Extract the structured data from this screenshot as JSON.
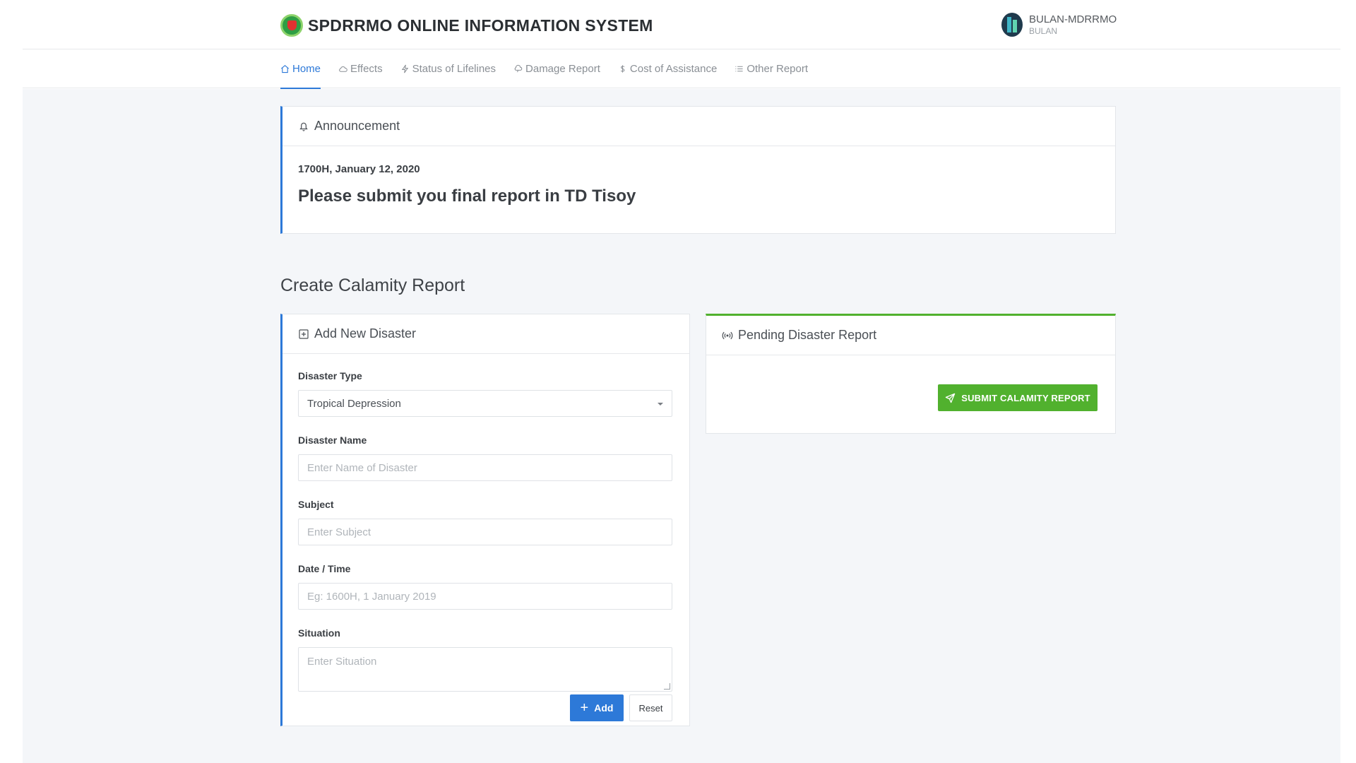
{
  "header": {
    "title": "SPDRRMO ONLINE INFORMATION SYSTEM",
    "user_name": "BULAN-MDRRMO",
    "user_sub": "BULAN"
  },
  "nav": {
    "items": [
      {
        "label": "Home",
        "icon": "home-icon",
        "active": true
      },
      {
        "label": "Effects",
        "icon": "cloud-icon",
        "active": false
      },
      {
        "label": "Status of Lifelines",
        "icon": "lightning-icon",
        "active": false
      },
      {
        "label": "Damage Report",
        "icon": "storm-cloud-icon",
        "active": false
      },
      {
        "label": "Cost of Assistance",
        "icon": "dollar-icon",
        "active": false
      },
      {
        "label": "Other Report",
        "icon": "list-icon",
        "active": false
      }
    ]
  },
  "announcement": {
    "title": "Announcement",
    "date": "1700H, January 12, 2020",
    "message": "Please submit you final report in TD Tisoy"
  },
  "section_title": "Create Calamity Report",
  "add_disaster": {
    "title": "Add New Disaster",
    "type_label": "Disaster Type",
    "type_value": "Tropical Depression",
    "name_label": "Disaster Name",
    "name_placeholder": "Enter Name of Disaster",
    "subject_label": "Subject",
    "subject_placeholder": "Enter Subject",
    "datetime_label": "Date / Time",
    "datetime_placeholder": "Eg: 1600H, 1 January 2019",
    "situation_label": "Situation",
    "situation_placeholder": "Enter Situation",
    "add_label": "Add",
    "reset_label": "Reset"
  },
  "pending": {
    "title": "Pending Disaster Report",
    "submit_label": "SUBMIT CALAMITY REPORT"
  },
  "colors": {
    "accent_blue": "#2d79d8",
    "accent_green": "#51b12e",
    "background": "#f4f6f9"
  }
}
